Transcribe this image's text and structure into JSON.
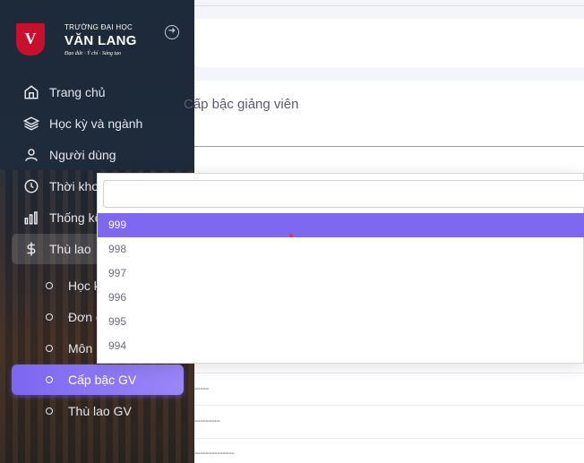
{
  "brand": {
    "top": "TRƯỜNG ĐẠI HỌC",
    "name": "VĂN LANG",
    "slogan": "Đạo đức · Ý chí · Sáng tạo"
  },
  "nav": {
    "items": [
      {
        "label": "Trang chủ",
        "icon": "home-icon"
      },
      {
        "label": "Học kỳ và ngành",
        "icon": "layers-icon"
      },
      {
        "label": "Người dùng",
        "icon": "user-icon"
      },
      {
        "label": "Thời khoá biểu",
        "icon": "clock-icon"
      },
      {
        "label": "Thống kê",
        "icon": "bar-chart-icon"
      },
      {
        "label": "Thù lao",
        "icon": "dollar-icon"
      }
    ],
    "sub_items": [
      {
        "label": "Học kỳ"
      },
      {
        "label": "Đơn giá"
      },
      {
        "label": "Môn học"
      },
      {
        "label": "Cấp bậc GV"
      },
      {
        "label": "Thù lao GV"
      }
    ]
  },
  "main": {
    "card_title": "Cấp bậc giảng viên",
    "dashes": [
      "-----",
      "---------",
      "--------------"
    ]
  },
  "dropdown": {
    "search_value": "",
    "options": [
      "999",
      "998",
      "997",
      "996",
      "995",
      "994"
    ],
    "selected": "999"
  },
  "colors": {
    "accent": "#7367f0",
    "sidebar_bg": "#1d2a3a",
    "brand_red": "#c8102e"
  }
}
